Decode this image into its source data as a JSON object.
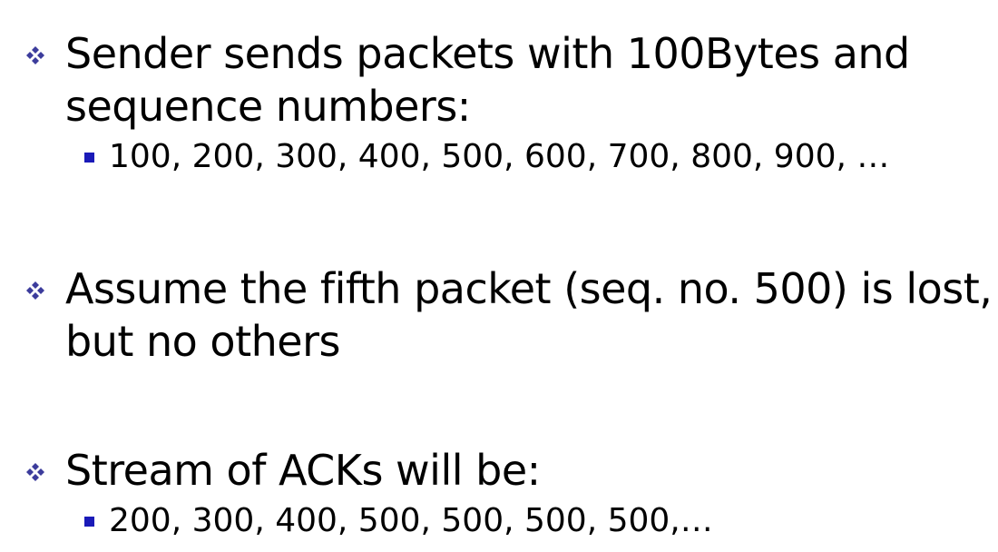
{
  "colors": {
    "text": "#000000",
    "bullet_diamond": "#3c3c9c",
    "bullet_square": "#1a1ab8",
    "background": "#ffffff"
  },
  "icons": {
    "level1": "four-diamond-bullet-icon",
    "level2": "square-bullet-icon"
  },
  "bullets": [
    {
      "lines": [
        "Sender sends packets with 100Bytes and",
        "sequence numbers:"
      ],
      "sub": "100, 200, 300, 400, 500, 600, 700, 800, 900, …"
    },
    {
      "lines": [
        "Assume the fifth packet (seq. no. 500) is lost,",
        "but no others"
      ]
    },
    {
      "lines": [
        "Stream of ACKs will be:"
      ],
      "sub": "200, 300, 400, 500, 500, 500, 500,…"
    }
  ]
}
